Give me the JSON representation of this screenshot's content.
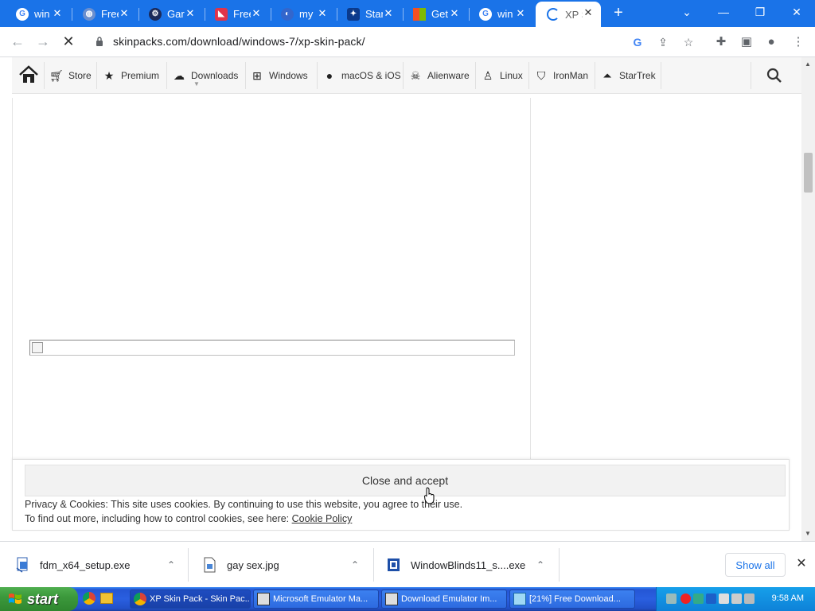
{
  "browser": {
    "tabs": [
      {
        "title": "win",
        "favicon": "google-icon",
        "favicon_color": "#ffffff"
      },
      {
        "title": "Free",
        "favicon": "globe-icon",
        "favicon_color": "#6a8fcf"
      },
      {
        "title": "Gar",
        "favicon": "gear-logo-icon",
        "favicon_color": "#1b2a5a"
      },
      {
        "title": "Free",
        "favicon": "red-logo-icon",
        "favicon_color": "#e0344a"
      },
      {
        "title": "my",
        "favicon": "blue-logo-icon",
        "favicon_color": "#3366cc"
      },
      {
        "title": "Star",
        "favicon": "star-logo-icon",
        "favicon_color": "#0b3a8c"
      },
      {
        "title": "Get",
        "favicon": "windows-logo-icon",
        "favicon_color": "#f25022"
      },
      {
        "title": "win",
        "favicon": "google-icon",
        "favicon_color": "#ffffff"
      },
      {
        "title": "XP S",
        "favicon": "loading-icon",
        "favicon_color": "#1a73e8"
      }
    ],
    "url": "skinpacks.com/download/windows-7/xp-skin-pack/"
  },
  "site_nav": {
    "items": [
      {
        "label": "Store",
        "icon": "cart-icon"
      },
      {
        "label": "Premium",
        "icon": "star-icon"
      },
      {
        "label": "Downloads",
        "icon": "cloud-download-icon"
      },
      {
        "label": "Windows",
        "icon": "windows-icon"
      },
      {
        "label": "macOS & iOS",
        "icon": "apple-icon"
      },
      {
        "label": "Alienware",
        "icon": "alien-icon"
      },
      {
        "label": "Linux",
        "icon": "linux-icon"
      },
      {
        "label": "IronMan",
        "icon": "ironman-icon"
      },
      {
        "label": "StarTrek",
        "icon": "startrek-icon"
      }
    ]
  },
  "cookie_banner": {
    "button": "Close and accept",
    "line1": "Privacy & Cookies: This site uses cookies. By continuing to use this website, you agree to their use.",
    "line2_prefix": "To find out more, including how to control cookies, see here: ",
    "link": "Cookie Policy"
  },
  "downloads": {
    "items": [
      {
        "name": "fdm_x64_setup.exe"
      },
      {
        "name": "gay sex.jpg"
      },
      {
        "name": "WindowBlinds11_s....exe"
      }
    ],
    "show_all": "Show all"
  },
  "taskbar": {
    "start": "start",
    "tasks": [
      {
        "label": "XP Skin Pack - Skin Pac..."
      },
      {
        "label": "Microsoft Emulator Ma..."
      },
      {
        "label": "Download Emulator Im..."
      },
      {
        "label": "[21%] Free Download..."
      }
    ],
    "clock": "9:58 AM"
  }
}
